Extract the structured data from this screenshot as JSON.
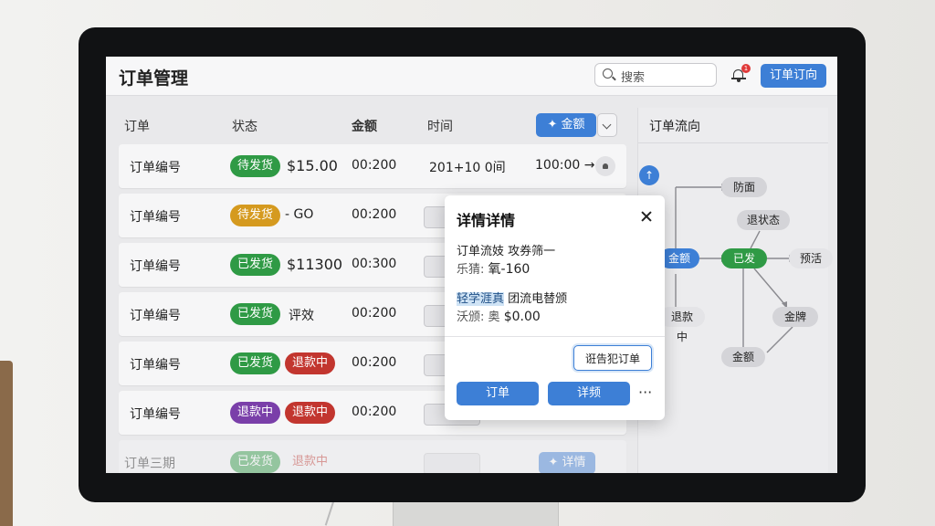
{
  "app": {
    "title": "订单管理"
  },
  "search": {
    "placeholder": "搜索"
  },
  "notifications": {
    "count": "1"
  },
  "header_button": "订单订向",
  "table": {
    "headers": {
      "order": "订单",
      "status": "状态",
      "amount": "金额",
      "time": "时间"
    },
    "amount_button": "金额",
    "rows": [
      {
        "id": "订单编号",
        "badges": [
          {
            "label": "待发货",
            "color": "green"
          }
        ],
        "amount": "$15.00",
        "time": "00:200",
        "date": "201+10 0间",
        "extra": "100:00 →"
      },
      {
        "id": "订单编号",
        "badges": [
          {
            "label": "待发货",
            "color": "yellow"
          }
        ],
        "amount": "- GO",
        "time": "00:200"
      },
      {
        "id": "订单编号",
        "badges": [
          {
            "label": "已发货",
            "color": "green"
          }
        ],
        "amount": "$11300",
        "time": "00:300"
      },
      {
        "id": "订单编号",
        "badges": [
          {
            "label": "已发货",
            "color": "green"
          }
        ],
        "amount": "评效",
        "time": "00:200"
      },
      {
        "id": "订单编号",
        "badges": [
          {
            "label": "已发货",
            "color": "green"
          },
          {
            "label": "退款中",
            "color": "red"
          }
        ],
        "amount": "",
        "time": "00:200"
      },
      {
        "id": "订单编号",
        "badges": [
          {
            "label": "退款中",
            "color": "purple"
          },
          {
            "label": "退款中",
            "color": "red"
          }
        ],
        "amount": "",
        "time": "00:200"
      },
      {
        "id": "订单三期",
        "badges": [
          {
            "label": "已发货",
            "color": "green"
          },
          {
            "label": "退款中",
            "color": "red"
          }
        ],
        "amount": "",
        "time": "",
        "faded": true
      }
    ],
    "bottom_button": "详情"
  },
  "panel": {
    "title": "订单流向",
    "nodes": {
      "n1": "防面",
      "n2": "退状态",
      "n3": "金额",
      "n4": "已发",
      "n5": "预活",
      "n6": "退款中",
      "n7": "金牌",
      "n8": "金额"
    }
  },
  "modal": {
    "title": "详情详情",
    "line1": "订单流妓 攻券筛一",
    "line2_label": "乐猜:",
    "line2_value": "氧-160",
    "line3_hl": "轻学涯真",
    "line3_rest": "团流电替颁",
    "line4_label": "沃颁:",
    "line4_mid": "奥",
    "line4_value": "$0.00",
    "outline_button": "诳告犯订单",
    "button1": "订单",
    "button2": "详频",
    "more": "···"
  },
  "colors": {
    "primary": "#3d7fd6",
    "green": "#2f9a45",
    "yellow": "#d59a1f",
    "red": "#c2362f",
    "purple": "#7a3fa9"
  }
}
